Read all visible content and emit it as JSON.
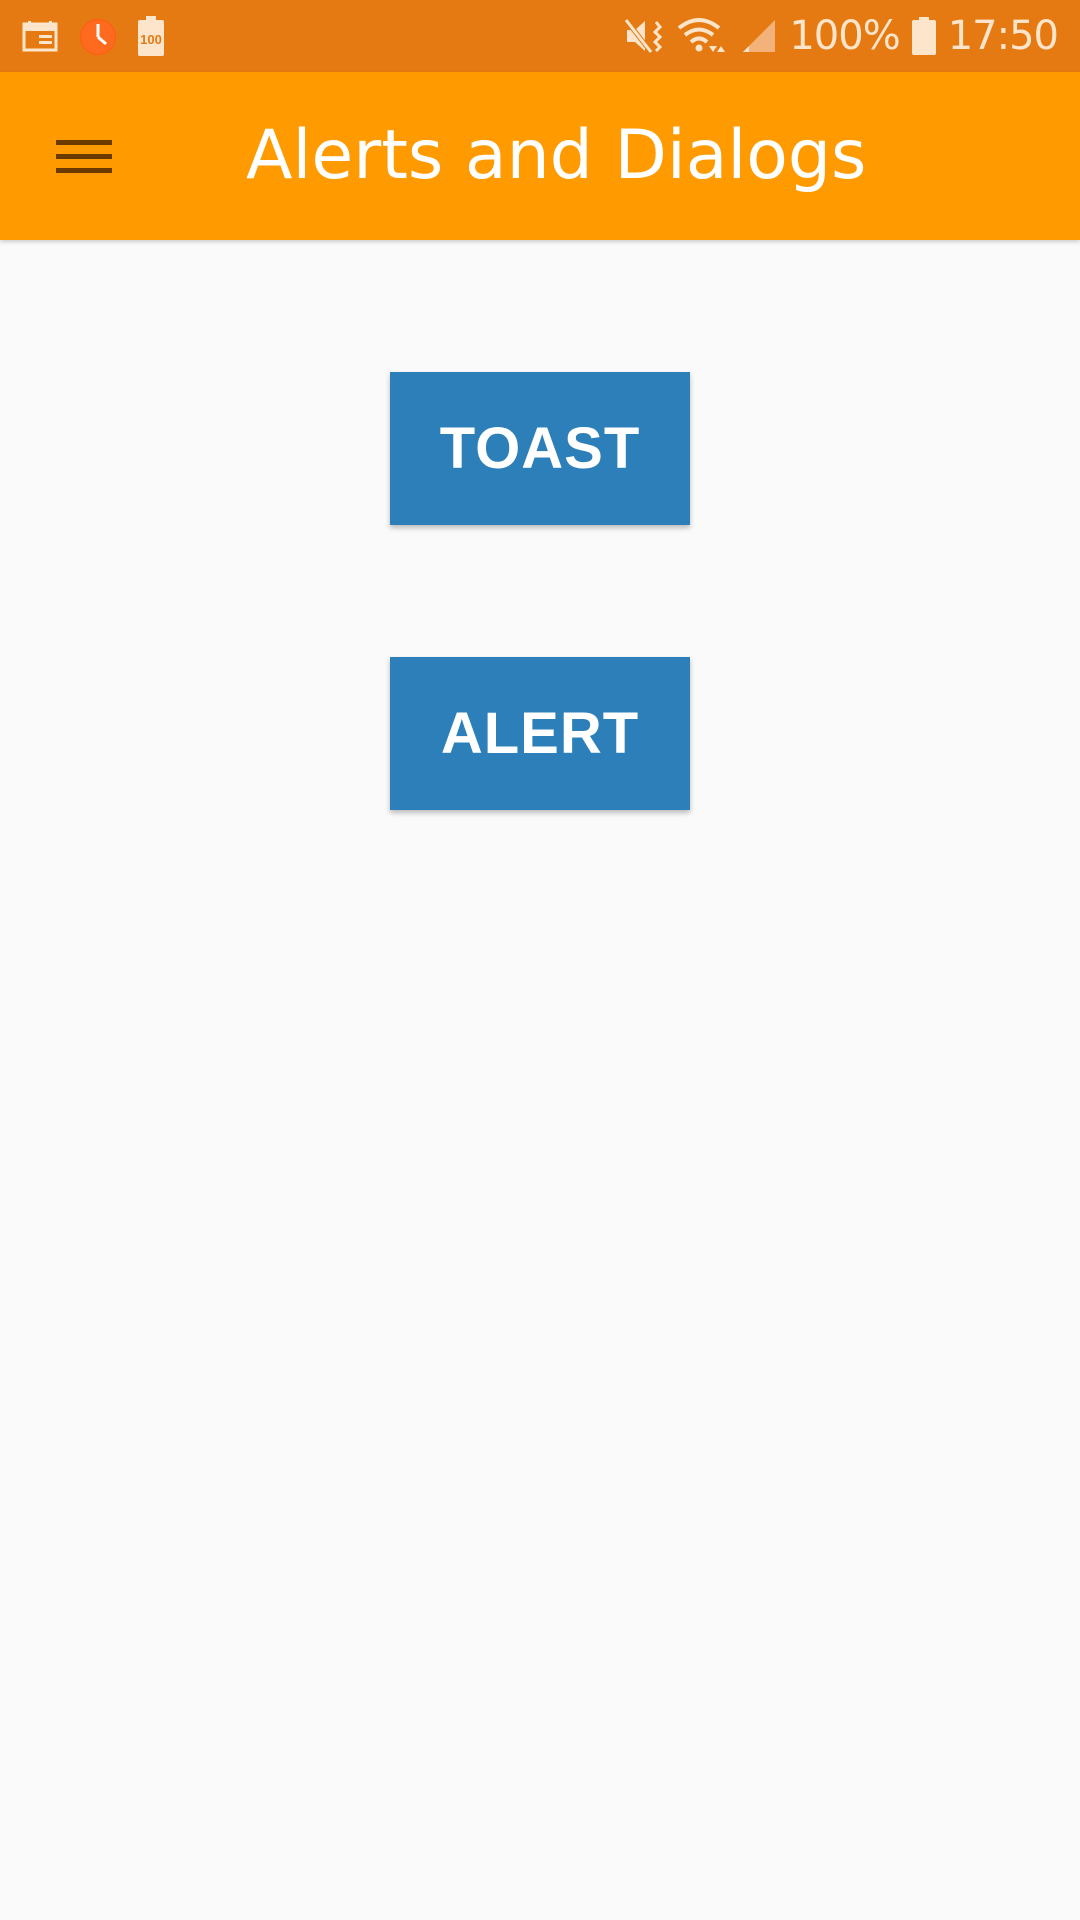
{
  "status_bar": {
    "left_icons": [
      "calendar-icon",
      "clock-icon",
      "battery-100-notification-icon"
    ],
    "badge_text": "100",
    "right_icons": [
      "mute-vibrate-icon",
      "wifi-icon",
      "signal-icon",
      "battery-icon"
    ],
    "battery_percent": "100%",
    "time": "17:50"
  },
  "app_bar": {
    "menu_icon": "hamburger-menu-icon",
    "title": "Alerts and Dialogs"
  },
  "main": {
    "toast_label": "TOAST",
    "alert_label": "ALERT"
  },
  "colors": {
    "status_bar": "#e67a12",
    "app_bar": "#ff9b00",
    "button": "#2c7fb8",
    "background": "#fafafa"
  }
}
